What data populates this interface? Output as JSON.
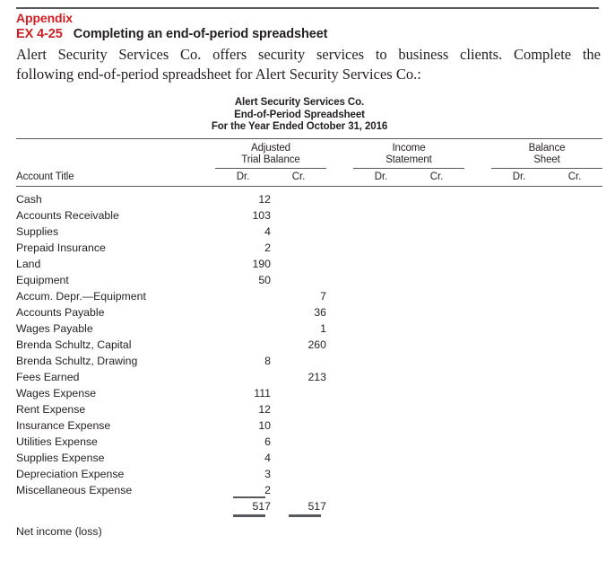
{
  "heading": {
    "appendix": "Appendix",
    "exercise_number": "EX 4-25",
    "exercise_title": "Completing an end-of-period spreadsheet"
  },
  "body": {
    "line1": "Alert Security Services Co. offers security services to business clients. Complete the",
    "line2": "following end-of-period spreadsheet for Alert Security Services Co.:"
  },
  "colors": {
    "accent_red": "#cc2026",
    "text": "#231f20",
    "rule": "#58595b"
  },
  "spreadsheet": {
    "title_line1": "Alert Security Services Co.",
    "title_line2": "End-of-Period Spreadsheet",
    "title_line3": "For the Year Ended October 31, 2016",
    "account_title_header": "Account Title",
    "column_groups": [
      {
        "line1": "Adjusted",
        "line2": "Trial Balance"
      },
      {
        "line1": "Income",
        "line2": "Statement"
      },
      {
        "line1": "Balance",
        "line2": "Sheet"
      }
    ],
    "dr_label": "Dr.",
    "cr_label": "Cr.",
    "rows": [
      {
        "account": "Cash",
        "atb_dr": "12",
        "atb_cr": "",
        "is_dr": "",
        "is_cr": "",
        "bs_dr": "",
        "bs_cr": ""
      },
      {
        "account": "Accounts Receivable",
        "atb_dr": "103",
        "atb_cr": "",
        "is_dr": "",
        "is_cr": "",
        "bs_dr": "",
        "bs_cr": ""
      },
      {
        "account": "Supplies",
        "atb_dr": "4",
        "atb_cr": "",
        "is_dr": "",
        "is_cr": "",
        "bs_dr": "",
        "bs_cr": ""
      },
      {
        "account": "Prepaid Insurance",
        "atb_dr": "2",
        "atb_cr": "",
        "is_dr": "",
        "is_cr": "",
        "bs_dr": "",
        "bs_cr": ""
      },
      {
        "account": "Land",
        "atb_dr": "190",
        "atb_cr": "",
        "is_dr": "",
        "is_cr": "",
        "bs_dr": "",
        "bs_cr": ""
      },
      {
        "account": "Equipment",
        "atb_dr": "50",
        "atb_cr": "",
        "is_dr": "",
        "is_cr": "",
        "bs_dr": "",
        "bs_cr": ""
      },
      {
        "account": "Accum. Depr.—Equipment",
        "atb_dr": "",
        "atb_cr": "7",
        "is_dr": "",
        "is_cr": "",
        "bs_dr": "",
        "bs_cr": ""
      },
      {
        "account": "Accounts Payable",
        "atb_dr": "",
        "atb_cr": "36",
        "is_dr": "",
        "is_cr": "",
        "bs_dr": "",
        "bs_cr": ""
      },
      {
        "account": "Wages Payable",
        "atb_dr": "",
        "atb_cr": "1",
        "is_dr": "",
        "is_cr": "",
        "bs_dr": "",
        "bs_cr": ""
      },
      {
        "account": "Brenda Schultz, Capital",
        "atb_dr": "",
        "atb_cr": "260",
        "is_dr": "",
        "is_cr": "",
        "bs_dr": "",
        "bs_cr": ""
      },
      {
        "account": "Brenda Schultz, Drawing",
        "atb_dr": "8",
        "atb_cr": "",
        "is_dr": "",
        "is_cr": "",
        "bs_dr": "",
        "bs_cr": ""
      },
      {
        "account": "Fees Earned",
        "atb_dr": "",
        "atb_cr": "213",
        "is_dr": "",
        "is_cr": "",
        "bs_dr": "",
        "bs_cr": ""
      },
      {
        "account": "Wages Expense",
        "atb_dr": "111",
        "atb_cr": "",
        "is_dr": "",
        "is_cr": "",
        "bs_dr": "",
        "bs_cr": ""
      },
      {
        "account": "Rent Expense",
        "atb_dr": "12",
        "atb_cr": "",
        "is_dr": "",
        "is_cr": "",
        "bs_dr": "",
        "bs_cr": ""
      },
      {
        "account": "Insurance Expense",
        "atb_dr": "10",
        "atb_cr": "",
        "is_dr": "",
        "is_cr": "",
        "bs_dr": "",
        "bs_cr": ""
      },
      {
        "account": "Utilities Expense",
        "atb_dr": "6",
        "atb_cr": "",
        "is_dr": "",
        "is_cr": "",
        "bs_dr": "",
        "bs_cr": ""
      },
      {
        "account": "Supplies Expense",
        "atb_dr": "4",
        "atb_cr": "",
        "is_dr": "",
        "is_cr": "",
        "bs_dr": "",
        "bs_cr": ""
      },
      {
        "account": "Depreciation Expense",
        "atb_dr": "3",
        "atb_cr": "",
        "is_dr": "",
        "is_cr": "",
        "bs_dr": "",
        "bs_cr": ""
      },
      {
        "account": "Miscellaneous Expense",
        "atb_dr": "2",
        "atb_cr": "",
        "is_dr": "",
        "is_cr": "",
        "bs_dr": "",
        "bs_cr": ""
      }
    ],
    "totals": {
      "account": "",
      "atb_dr": "517",
      "atb_cr": "517",
      "is_dr": "",
      "is_cr": "",
      "bs_dr": "",
      "bs_cr": ""
    },
    "net_income_label": "Net income (loss)"
  }
}
